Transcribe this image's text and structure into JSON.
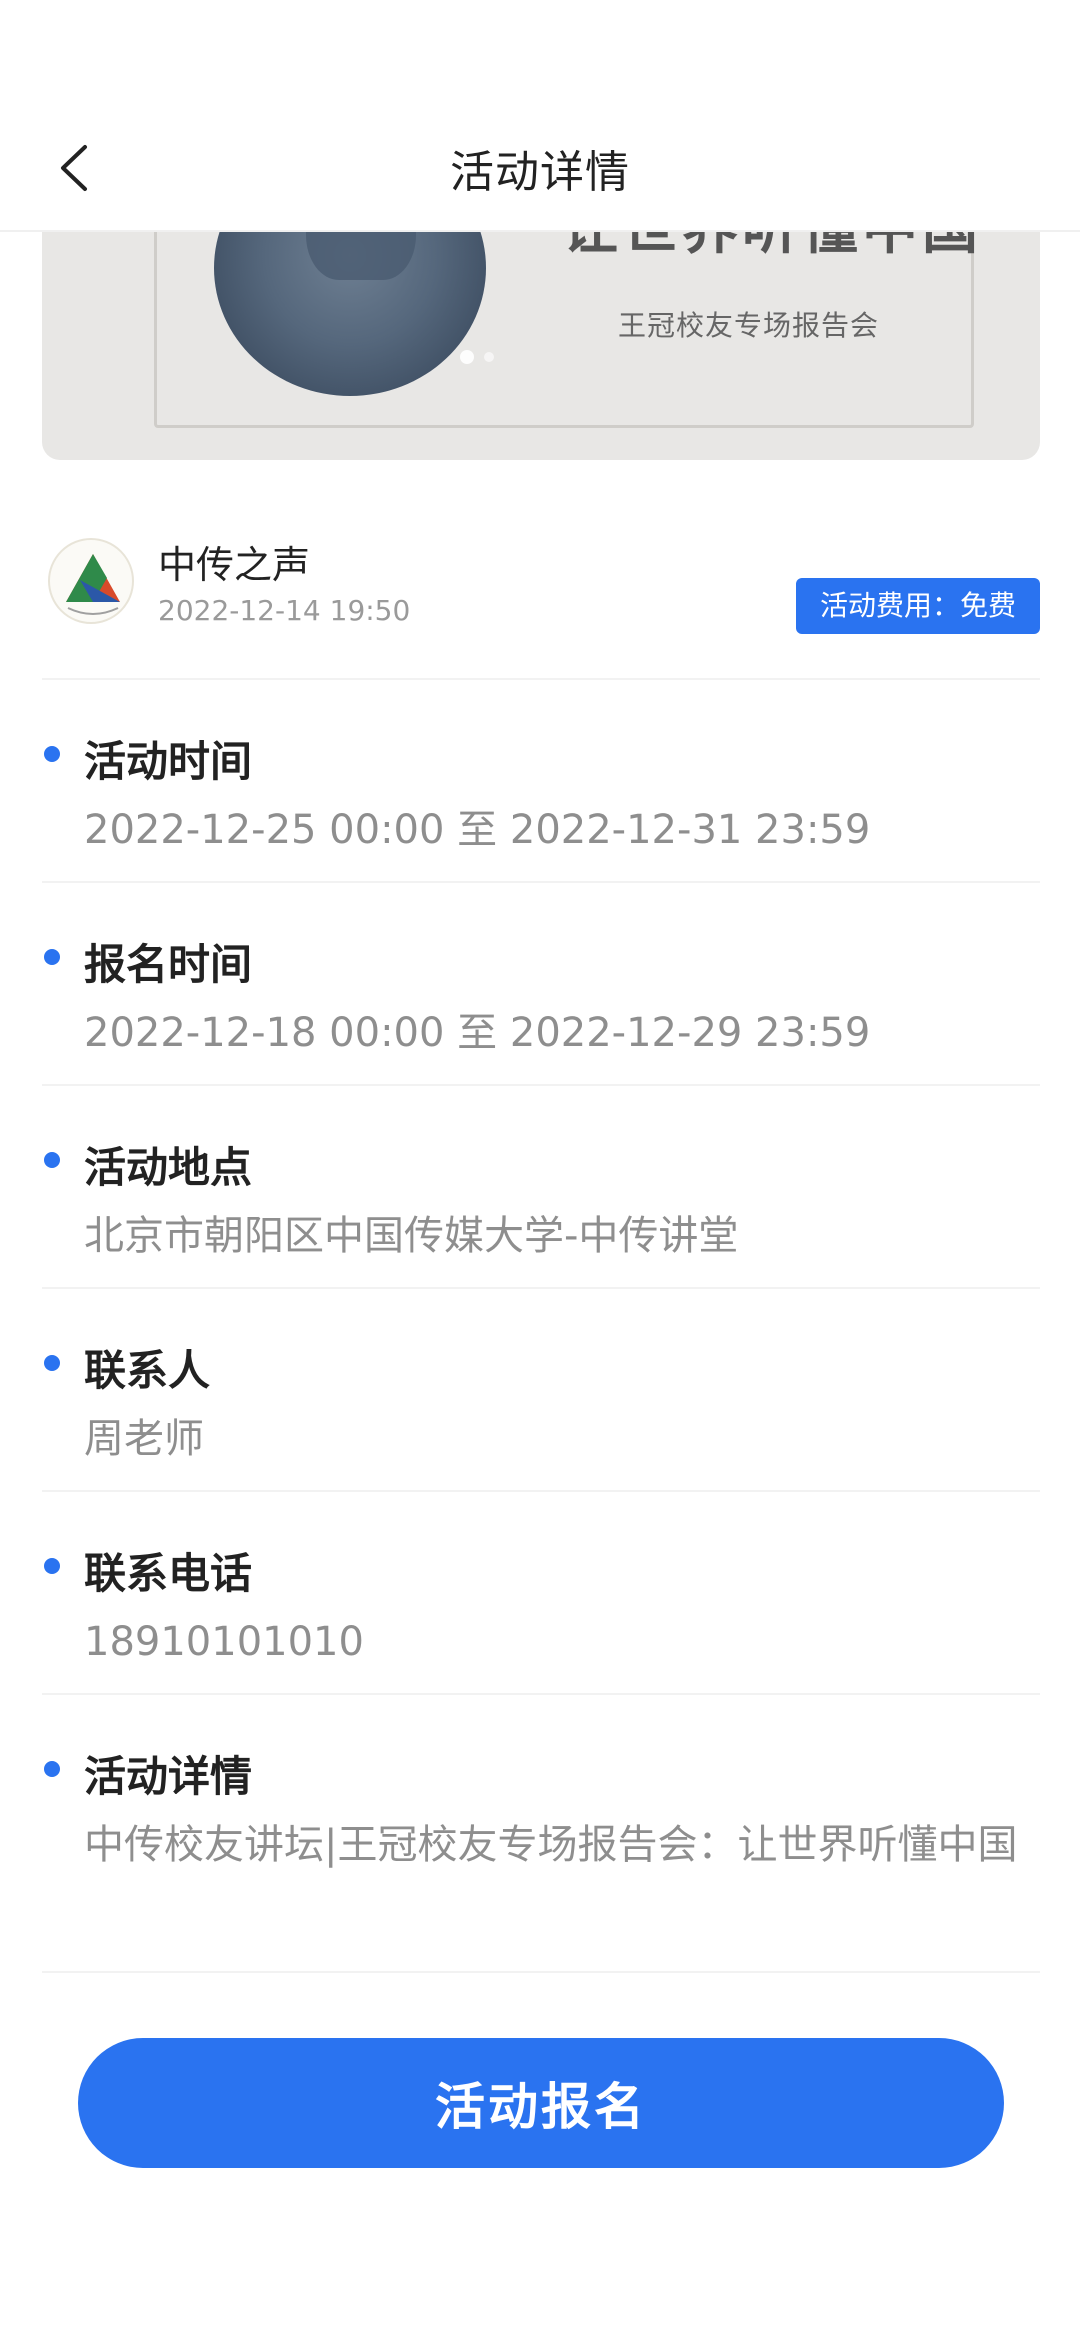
{
  "header": {
    "title": "活动详情",
    "back_icon": "chevron-left-icon"
  },
  "banner": {
    "headline": "让世界听懂中国",
    "subtitle": "王冠校友专场报告会"
  },
  "publisher": {
    "name": "中传之声",
    "time": "2022-12-14 19:50",
    "fee_badge": "活动费用：免费"
  },
  "sections": [
    {
      "label": "活动时间",
      "value": "2022-12-25 00:00 至 2022-12-31 23:59"
    },
    {
      "label": "报名时间",
      "value": "2022-12-18 00:00 至 2022-12-29 23:59"
    },
    {
      "label": "活动地点",
      "value": "北京市朝阳区中国传媒大学-中传讲堂"
    },
    {
      "label": "联系人",
      "value": "周老师"
    },
    {
      "label": "联系电话",
      "value": "18910101010"
    },
    {
      "label": "活动详情",
      "value": "中传校友讲坛|王冠校友专场报告会：让世界听懂中国"
    }
  ],
  "actions": {
    "signup_label": "活动报名"
  },
  "colors": {
    "accent": "#2a73f0",
    "muted_text": "#8e8e8e",
    "divider": "#f2f2f2"
  }
}
